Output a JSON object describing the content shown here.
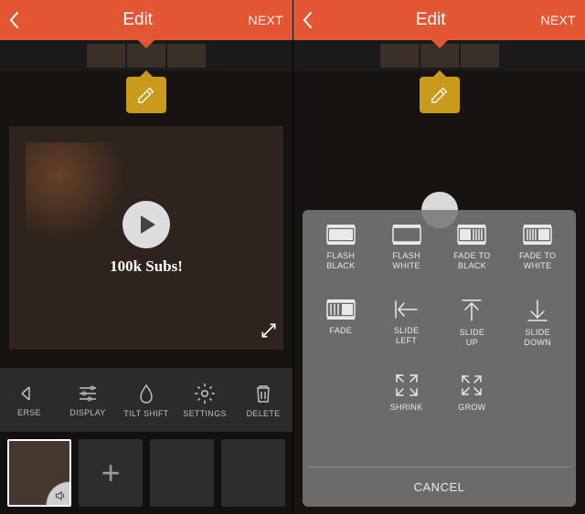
{
  "header": {
    "title": "Edit",
    "next": "NEXT"
  },
  "left": {
    "overlay_text": "100k Subs!",
    "tools": {
      "reverse": "ERSE",
      "display": "DISPLAY",
      "tilt_shift": "TILT SHIFT",
      "settings": "SETTINGS",
      "delete": "DELETE"
    }
  },
  "right": {
    "transitions": [
      {
        "key": "flash_black",
        "label": "FLASH\nBLACK"
      },
      {
        "key": "flash_white",
        "label": "FLASH\nWHITE"
      },
      {
        "key": "fade_to_black",
        "label": "FADE TO\nBLACK"
      },
      {
        "key": "fade_to_white",
        "label": "FADE TO\nWHITE"
      },
      {
        "key": "fade",
        "label": "FADE"
      },
      {
        "key": "slide_left",
        "label": "SLIDE\nLEFT"
      },
      {
        "key": "slide_up",
        "label": "SLIDE\nUP"
      },
      {
        "key": "slide_down",
        "label": "SLIDE\nDOWN"
      },
      {
        "key": "shrink",
        "label": "SHRINK"
      },
      {
        "key": "grow",
        "label": "GROW"
      }
    ],
    "cancel": "CANCEL"
  }
}
